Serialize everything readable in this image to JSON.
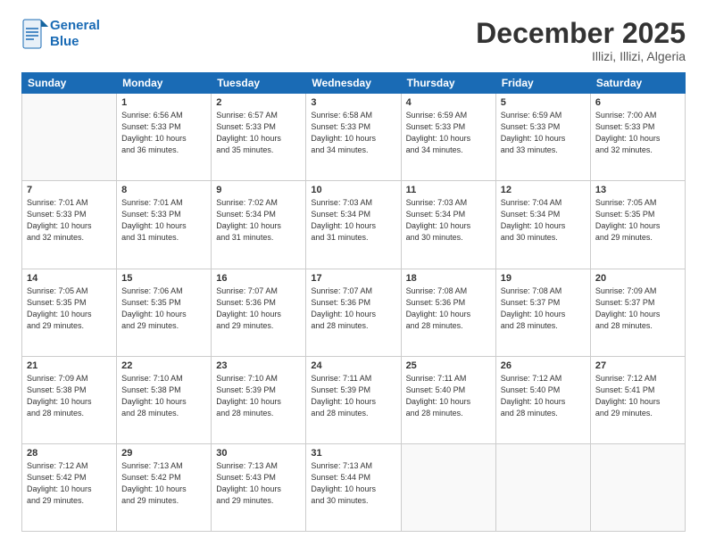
{
  "logo": {
    "line1": "General",
    "line2": "Blue"
  },
  "title": "December 2025",
  "location": "Illizi, Illizi, Algeria",
  "days_header": [
    "Sunday",
    "Monday",
    "Tuesday",
    "Wednesday",
    "Thursday",
    "Friday",
    "Saturday"
  ],
  "weeks": [
    [
      {
        "num": "",
        "info": ""
      },
      {
        "num": "1",
        "info": "Sunrise: 6:56 AM\nSunset: 5:33 PM\nDaylight: 10 hours\nand 36 minutes."
      },
      {
        "num": "2",
        "info": "Sunrise: 6:57 AM\nSunset: 5:33 PM\nDaylight: 10 hours\nand 35 minutes."
      },
      {
        "num": "3",
        "info": "Sunrise: 6:58 AM\nSunset: 5:33 PM\nDaylight: 10 hours\nand 34 minutes."
      },
      {
        "num": "4",
        "info": "Sunrise: 6:59 AM\nSunset: 5:33 PM\nDaylight: 10 hours\nand 34 minutes."
      },
      {
        "num": "5",
        "info": "Sunrise: 6:59 AM\nSunset: 5:33 PM\nDaylight: 10 hours\nand 33 minutes."
      },
      {
        "num": "6",
        "info": "Sunrise: 7:00 AM\nSunset: 5:33 PM\nDaylight: 10 hours\nand 32 minutes."
      }
    ],
    [
      {
        "num": "7",
        "info": "Sunrise: 7:01 AM\nSunset: 5:33 PM\nDaylight: 10 hours\nand 32 minutes."
      },
      {
        "num": "8",
        "info": "Sunrise: 7:01 AM\nSunset: 5:33 PM\nDaylight: 10 hours\nand 31 minutes."
      },
      {
        "num": "9",
        "info": "Sunrise: 7:02 AM\nSunset: 5:34 PM\nDaylight: 10 hours\nand 31 minutes."
      },
      {
        "num": "10",
        "info": "Sunrise: 7:03 AM\nSunset: 5:34 PM\nDaylight: 10 hours\nand 31 minutes."
      },
      {
        "num": "11",
        "info": "Sunrise: 7:03 AM\nSunset: 5:34 PM\nDaylight: 10 hours\nand 30 minutes."
      },
      {
        "num": "12",
        "info": "Sunrise: 7:04 AM\nSunset: 5:34 PM\nDaylight: 10 hours\nand 30 minutes."
      },
      {
        "num": "13",
        "info": "Sunrise: 7:05 AM\nSunset: 5:35 PM\nDaylight: 10 hours\nand 29 minutes."
      }
    ],
    [
      {
        "num": "14",
        "info": "Sunrise: 7:05 AM\nSunset: 5:35 PM\nDaylight: 10 hours\nand 29 minutes."
      },
      {
        "num": "15",
        "info": "Sunrise: 7:06 AM\nSunset: 5:35 PM\nDaylight: 10 hours\nand 29 minutes."
      },
      {
        "num": "16",
        "info": "Sunrise: 7:07 AM\nSunset: 5:36 PM\nDaylight: 10 hours\nand 29 minutes."
      },
      {
        "num": "17",
        "info": "Sunrise: 7:07 AM\nSunset: 5:36 PM\nDaylight: 10 hours\nand 28 minutes."
      },
      {
        "num": "18",
        "info": "Sunrise: 7:08 AM\nSunset: 5:36 PM\nDaylight: 10 hours\nand 28 minutes."
      },
      {
        "num": "19",
        "info": "Sunrise: 7:08 AM\nSunset: 5:37 PM\nDaylight: 10 hours\nand 28 minutes."
      },
      {
        "num": "20",
        "info": "Sunrise: 7:09 AM\nSunset: 5:37 PM\nDaylight: 10 hours\nand 28 minutes."
      }
    ],
    [
      {
        "num": "21",
        "info": "Sunrise: 7:09 AM\nSunset: 5:38 PM\nDaylight: 10 hours\nand 28 minutes."
      },
      {
        "num": "22",
        "info": "Sunrise: 7:10 AM\nSunset: 5:38 PM\nDaylight: 10 hours\nand 28 minutes."
      },
      {
        "num": "23",
        "info": "Sunrise: 7:10 AM\nSunset: 5:39 PM\nDaylight: 10 hours\nand 28 minutes."
      },
      {
        "num": "24",
        "info": "Sunrise: 7:11 AM\nSunset: 5:39 PM\nDaylight: 10 hours\nand 28 minutes."
      },
      {
        "num": "25",
        "info": "Sunrise: 7:11 AM\nSunset: 5:40 PM\nDaylight: 10 hours\nand 28 minutes."
      },
      {
        "num": "26",
        "info": "Sunrise: 7:12 AM\nSunset: 5:40 PM\nDaylight: 10 hours\nand 28 minutes."
      },
      {
        "num": "27",
        "info": "Sunrise: 7:12 AM\nSunset: 5:41 PM\nDaylight: 10 hours\nand 29 minutes."
      }
    ],
    [
      {
        "num": "28",
        "info": "Sunrise: 7:12 AM\nSunset: 5:42 PM\nDaylight: 10 hours\nand 29 minutes."
      },
      {
        "num": "29",
        "info": "Sunrise: 7:13 AM\nSunset: 5:42 PM\nDaylight: 10 hours\nand 29 minutes."
      },
      {
        "num": "30",
        "info": "Sunrise: 7:13 AM\nSunset: 5:43 PM\nDaylight: 10 hours\nand 29 minutes."
      },
      {
        "num": "31",
        "info": "Sunrise: 7:13 AM\nSunset: 5:44 PM\nDaylight: 10 hours\nand 30 minutes."
      },
      {
        "num": "",
        "info": ""
      },
      {
        "num": "",
        "info": ""
      },
      {
        "num": "",
        "info": ""
      }
    ]
  ]
}
